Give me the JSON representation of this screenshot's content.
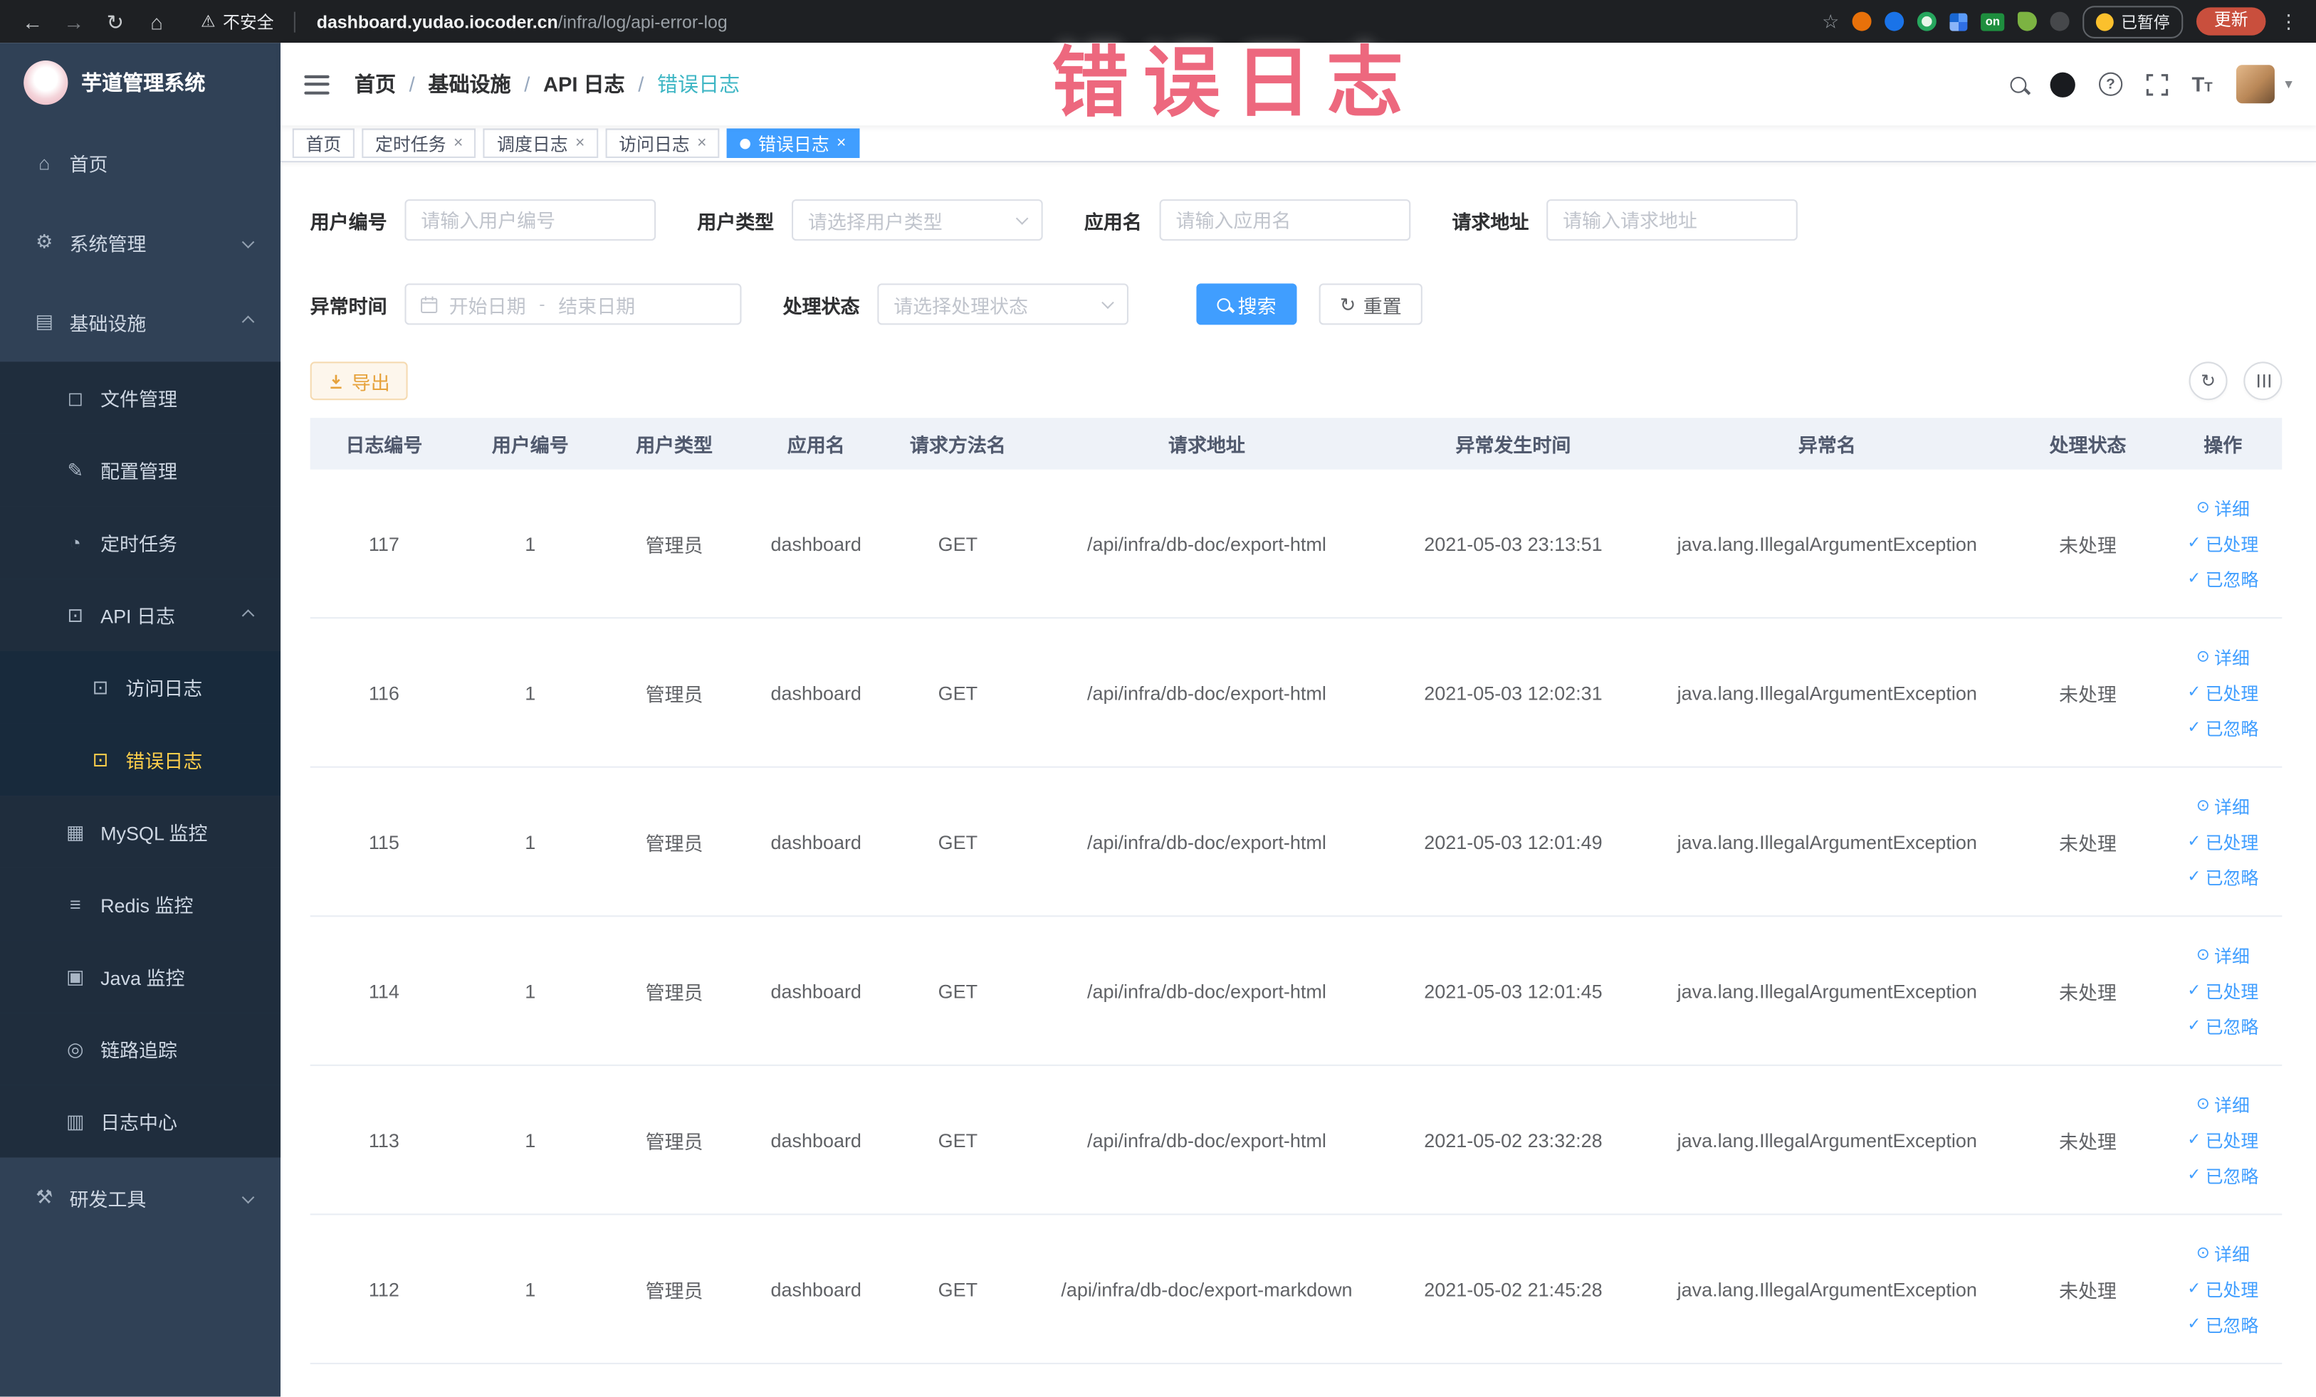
{
  "colors": {
    "accent_blue": "#409eff",
    "sidebar_bg": "#304156",
    "sidebar_submenu_bg": "#1f2d3d",
    "sidebar_active": "#ffd04b",
    "breadcrumb_current": "#3eb6c4",
    "warning_orange": "#e6a23c",
    "annotation_pink": "#e9425e",
    "table_header_bg": "#eef2f8"
  },
  "icons": {
    "back": "←",
    "forward": "→",
    "reload": "↻",
    "home": "⌂",
    "warning": "⚠",
    "star": "☆",
    "more_vertical": "⋮",
    "question": "?",
    "close": "×",
    "caret_down": "▾",
    "check": "✓",
    "view": "⊙",
    "refresh": "↻",
    "columns": "☰",
    "font_size": "T"
  },
  "browser": {
    "security_label": "不安全",
    "url_host": "dashboard.yudao.iocoder.cn",
    "url_path": "/infra/log/api-error-log",
    "ext_on_badge": "on",
    "paused_label": "已暂停",
    "update_label": "更新"
  },
  "annotation": {
    "text": "错误日志"
  },
  "sidebar": {
    "logo_title": "芋道管理系统",
    "items": [
      {
        "label": "首页",
        "icon": "⌂"
      },
      {
        "label": "系统管理",
        "icon": "⚙"
      },
      {
        "label": "基础设施",
        "icon": "▤"
      },
      {
        "label": "文件管理",
        "icon": "◻"
      },
      {
        "label": "配置管理",
        "icon": "✎"
      },
      {
        "label": "定时任务",
        "icon": "◔"
      },
      {
        "label": "API 日志",
        "icon": "⊡"
      },
      {
        "label": "访问日志",
        "icon": "⊡"
      },
      {
        "label": "错误日志",
        "icon": "⊡"
      },
      {
        "label": "MySQL 监控",
        "icon": "▦"
      },
      {
        "label": "Redis 监控",
        "icon": "≡"
      },
      {
        "label": "Java 监控",
        "icon": "▣"
      },
      {
        "label": "链路追踪",
        "icon": "◎"
      },
      {
        "label": "日志中心",
        "icon": "▥"
      },
      {
        "label": "研发工具",
        "icon": "⚒"
      }
    ]
  },
  "header": {
    "breadcrumb_separator": "/",
    "breadcrumb": [
      {
        "label": "首页"
      },
      {
        "label": "基础设施"
      },
      {
        "label": "API 日志"
      },
      {
        "label": "错误日志"
      }
    ]
  },
  "tabs": [
    {
      "label": "首页"
    },
    {
      "label": "定时任务"
    },
    {
      "label": "调度日志"
    },
    {
      "label": "访问日志"
    },
    {
      "label": "错误日志"
    }
  ],
  "filters": {
    "user_id": {
      "label": "用户编号",
      "placeholder": "请输入用户编号"
    },
    "user_type": {
      "label": "用户类型",
      "placeholder": "请选择用户类型"
    },
    "app_name": {
      "label": "应用名",
      "placeholder": "请输入应用名"
    },
    "request_url": {
      "label": "请求地址",
      "placeholder": "请输入请求地址"
    },
    "exception_time": {
      "label": "异常时间",
      "start_placeholder": "开始日期",
      "separator": "-",
      "end_placeholder": "结束日期"
    },
    "process_status": {
      "label": "处理状态",
      "placeholder": "请选择处理状态"
    },
    "search_label": "搜索",
    "reset_label": "重置"
  },
  "toolbar": {
    "export_label": "导出"
  },
  "table": {
    "columns": [
      "日志编号",
      "用户编号",
      "用户类型",
      "应用名",
      "请求方法名",
      "请求地址",
      "异常发生时间",
      "异常名",
      "处理状态",
      "操作"
    ],
    "actions": {
      "detail": "详细",
      "processed": "已处理",
      "ignored": "已忽略"
    },
    "rows": [
      {
        "log_id": "117",
        "user_id": "1",
        "user_type": "管理员",
        "app_name": "dashboard",
        "method": "GET",
        "url": "/api/infra/db-doc/export-html",
        "time": "2021-05-03 23:13:51",
        "exception": "java.lang.IllegalArgumentException",
        "status": "未处理"
      },
      {
        "log_id": "116",
        "user_id": "1",
        "user_type": "管理员",
        "app_name": "dashboard",
        "method": "GET",
        "url": "/api/infra/db-doc/export-html",
        "time": "2021-05-03 12:02:31",
        "exception": "java.lang.IllegalArgumentException",
        "status": "未处理"
      },
      {
        "log_id": "115",
        "user_id": "1",
        "user_type": "管理员",
        "app_name": "dashboard",
        "method": "GET",
        "url": "/api/infra/db-doc/export-html",
        "time": "2021-05-03 12:01:49",
        "exception": "java.lang.IllegalArgumentException",
        "status": "未处理"
      },
      {
        "log_id": "114",
        "user_id": "1",
        "user_type": "管理员",
        "app_name": "dashboard",
        "method": "GET",
        "url": "/api/infra/db-doc/export-html",
        "time": "2021-05-03 12:01:45",
        "exception": "java.lang.IllegalArgumentException",
        "status": "未处理"
      },
      {
        "log_id": "113",
        "user_id": "1",
        "user_type": "管理员",
        "app_name": "dashboard",
        "method": "GET",
        "url": "/api/infra/db-doc/export-html",
        "time": "2021-05-02 23:32:28",
        "exception": "java.lang.IllegalArgumentException",
        "status": "未处理"
      },
      {
        "log_id": "112",
        "user_id": "1",
        "user_type": "管理员",
        "app_name": "dashboard",
        "method": "GET",
        "url": "/api/infra/db-doc/export-markdown",
        "time": "2021-05-02 21:45:28",
        "exception": "java.lang.IllegalArgumentException",
        "status": "未处理"
      }
    ]
  }
}
